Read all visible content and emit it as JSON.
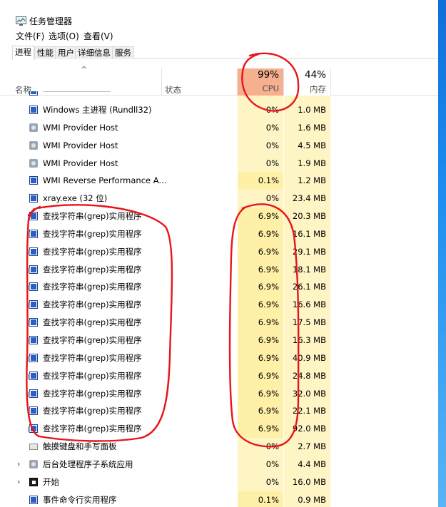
{
  "window": {
    "title": "任务管理器",
    "menu": [
      "文件(F)",
      "选项(O)",
      "查看(V)"
    ],
    "tabs": [
      "进程",
      "性能",
      "用户",
      "详细信息",
      "服务"
    ],
    "active_tab": "进程"
  },
  "header": {
    "sort_arrow": "^",
    "name_label": "名称",
    "status_label": "状态",
    "cpu_percent": "99%",
    "cpu_label": "CPU",
    "mem_percent": "44%",
    "mem_label": "内存"
  },
  "processes": [
    {
      "name": "Windows 主进程 (Rundll32)",
      "cpu": "0%",
      "mem": "1.0 MB",
      "icon": "window-icon",
      "expander": false
    },
    {
      "name": "WMI Provider Host",
      "cpu": "0%",
      "mem": "1.6 MB",
      "icon": "gear-icon",
      "expander": false
    },
    {
      "name": "WMI Provider Host",
      "cpu": "0%",
      "mem": "4.5 MB",
      "icon": "gear-icon",
      "expander": false
    },
    {
      "name": "WMI Provider Host",
      "cpu": "0%",
      "mem": "1.9 MB",
      "icon": "gear-icon",
      "expander": false
    },
    {
      "name": "WMI Reverse Performance A...",
      "cpu": "0.1%",
      "mem": "1.2 MB",
      "icon": "window-icon",
      "expander": false
    },
    {
      "name": "xray.exe (32 位)",
      "cpu": "0%",
      "mem": "23.4 MB",
      "icon": "window-icon",
      "expander": false
    },
    {
      "name": "查找字符串(grep)实用程序",
      "cpu": "6.9%",
      "mem": "20.3 MB",
      "icon": "window-icon",
      "expander": false
    },
    {
      "name": "查找字符串(grep)实用程序",
      "cpu": "6.9%",
      "mem": "16.1 MB",
      "icon": "window-icon",
      "expander": false
    },
    {
      "name": "查找字符串(grep)实用程序",
      "cpu": "6.9%",
      "mem": "29.1 MB",
      "icon": "window-icon",
      "expander": false
    },
    {
      "name": "查找字符串(grep)实用程序",
      "cpu": "6.9%",
      "mem": "18.1 MB",
      "icon": "window-icon",
      "expander": false
    },
    {
      "name": "查找字符串(grep)实用程序",
      "cpu": "6.9%",
      "mem": "26.1 MB",
      "icon": "window-icon",
      "expander": false
    },
    {
      "name": "查找字符串(grep)实用程序",
      "cpu": "6.9%",
      "mem": "16.6 MB",
      "icon": "window-icon",
      "expander": false
    },
    {
      "name": "查找字符串(grep)实用程序",
      "cpu": "6.9%",
      "mem": "17.5 MB",
      "icon": "window-icon",
      "expander": false
    },
    {
      "name": "查找字符串(grep)实用程序",
      "cpu": "6.9%",
      "mem": "16.3 MB",
      "icon": "window-icon",
      "expander": false
    },
    {
      "name": "查找字符串(grep)实用程序",
      "cpu": "6.9%",
      "mem": "40.9 MB",
      "icon": "window-icon",
      "expander": false
    },
    {
      "name": "查找字符串(grep)实用程序",
      "cpu": "6.9%",
      "mem": "24.8 MB",
      "icon": "window-icon",
      "expander": false
    },
    {
      "name": "查找字符串(grep)实用程序",
      "cpu": "6.9%",
      "mem": "32.0 MB",
      "icon": "window-icon",
      "expander": false
    },
    {
      "name": "查找字符串(grep)实用程序",
      "cpu": "6.9%",
      "mem": "22.1 MB",
      "icon": "window-icon",
      "expander": false
    },
    {
      "name": "查找字符串(grep)实用程序",
      "cpu": "6.9%",
      "mem": "92.0 MB",
      "icon": "window-icon",
      "expander": false
    },
    {
      "name": "触摸键盘和手写面板",
      "cpu": "0%",
      "mem": "2.7 MB",
      "icon": "keyboard-icon",
      "expander": false
    },
    {
      "name": "后台处理程序子系统应用",
      "cpu": "0%",
      "mem": "4.4 MB",
      "icon": "printer-icon",
      "expander": true
    },
    {
      "name": "开始",
      "cpu": "0%",
      "mem": "16.0 MB",
      "icon": "start-icon",
      "expander": true
    },
    {
      "name": "事件命令行实用程序",
      "cpu": "0.1%",
      "mem": "0.9 MB",
      "icon": "window-icon",
      "expander": false
    }
  ],
  "colors": {
    "cpu_header_bg": "#f6b08f",
    "column_bg": "#fff4c4",
    "hot_cell_bg": "#fff0a8",
    "annotation_red": "#e8141b"
  }
}
